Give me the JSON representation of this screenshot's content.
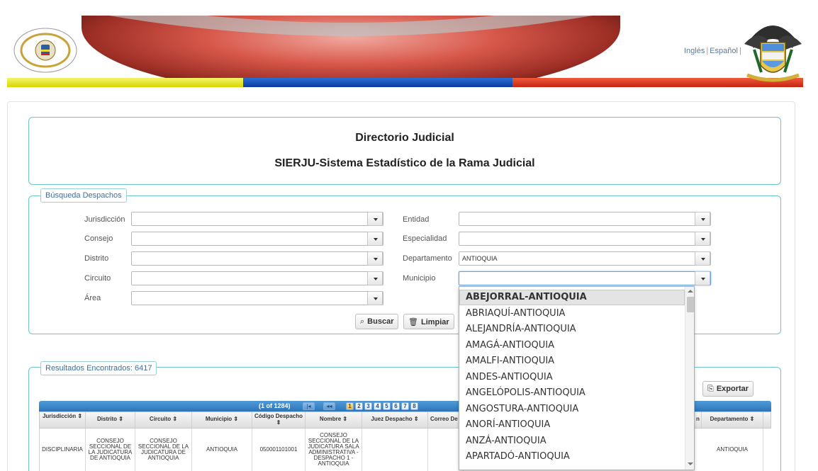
{
  "header": {
    "lang_en": "Inglés",
    "lang_es": "Español",
    "separator": "|"
  },
  "title": {
    "line1": "Directorio Judicial",
    "line2": "SIERJU-Sistema Estadístico de la Rama Judicial"
  },
  "search": {
    "legend": "Búsqueda Despachos",
    "fields_left": [
      {
        "label": "Jurisdicción",
        "value": ""
      },
      {
        "label": "Consejo",
        "value": ""
      },
      {
        "label": "Distrito",
        "value": ""
      },
      {
        "label": "Circuito",
        "value": ""
      },
      {
        "label": "Área",
        "value": ""
      }
    ],
    "fields_right": [
      {
        "label": "Entidad",
        "value": ""
      },
      {
        "label": "Especialidad",
        "value": ""
      },
      {
        "label": "Departamento",
        "value": "ANTIOQUIA"
      },
      {
        "label": "Municipio",
        "value": ""
      }
    ],
    "buscar_label": "Buscar",
    "limpiar_label": "Limpiar"
  },
  "municipio_dropdown": {
    "options": [
      "ABEJORRAL-ANTIOQUIA",
      "ABRIAQUÍ-ANTIOQUIA",
      "ALEJANDRÍA-ANTIOQUIA",
      "AMAGÁ-ANTIOQUIA",
      "AMALFI-ANTIOQUIA",
      "ANDES-ANTIOQUIA",
      "ANGELÓPOLIS-ANTIOQUIA",
      "ANGOSTURA-ANTIOQUIA",
      "ANORÍ-ANTIOQUIA",
      "ANZÁ-ANTIOQUIA",
      "APARTADÓ-ANTIOQUIA"
    ],
    "highlighted": "ABEJORRAL-ANTIOQUIA"
  },
  "results": {
    "legend": "Resultados Encontrados: 6417",
    "export_label": "Exportar",
    "page_count": "(1 of 1284)",
    "pager_first": "|◂",
    "pager_prev": "◂◂",
    "pages": [
      "1",
      "2",
      "3",
      "4",
      "5",
      "6",
      "7",
      "8"
    ],
    "columns": [
      "Jurisdicción ⇕",
      "Distrito ⇕",
      "Circuito ⇕",
      "Municipio ⇕",
      "Código Despacho ⇕",
      "Nombre ⇕",
      "Juez Despacho ⇕",
      "Correo De",
      "n",
      "Departamento ⇕"
    ],
    "rows": [
      {
        "jurisdiccion": "DISCIPLINARIA",
        "distrito": "CONSEJO SECCIONAL DE LA JUDICATURA DE ANTIOQUIA",
        "circuito": "CONSEJO SECCIONAL DE LA JUDICATURA DE ANTIOQUIA",
        "municipio": "ANTIOQUIA",
        "codigo": "050001101001",
        "nombre": "CONSEJO SECCIONAL DE LA JUDICATURA SALA ADMINISTRATIVA - DESPACHO 1 - ANTIOQUIA",
        "juez": "",
        "correo": "",
        "departamento": "ANTIOQUIA"
      }
    ]
  },
  "colors": {
    "accent": "#6ec4cf",
    "legend_text": "#3f6fa5",
    "pager_blue": "#2c74b8"
  }
}
